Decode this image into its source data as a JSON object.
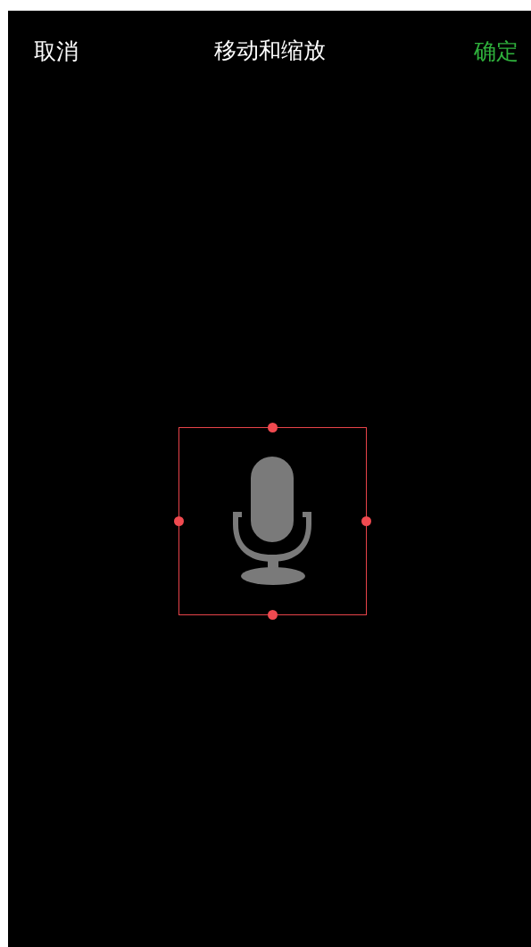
{
  "header": {
    "cancel": "取消",
    "title": "移动和缩放",
    "confirm": "确定"
  }
}
